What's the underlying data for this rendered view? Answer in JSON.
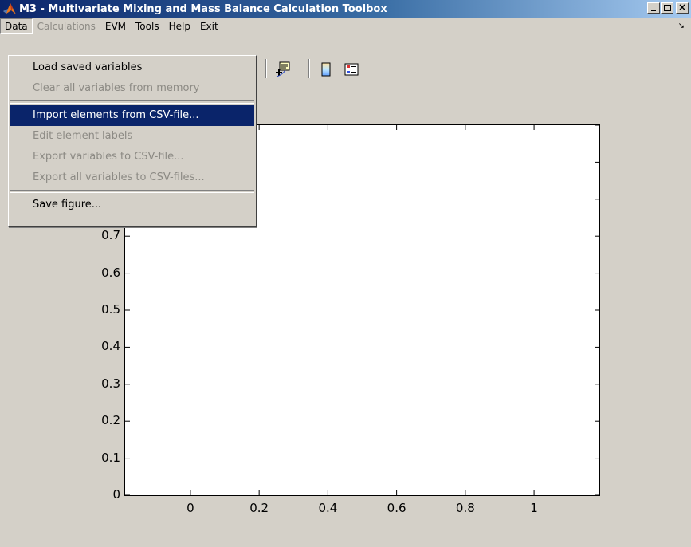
{
  "window": {
    "title": "M3 - Multivariate Mixing and Mass Balance Calculation Toolbox",
    "close_glyph": "×"
  },
  "menubar": {
    "items": [
      {
        "label": "Data",
        "enabled": true,
        "open": true
      },
      {
        "label": "Calculations",
        "enabled": false
      },
      {
        "label": "EVM",
        "enabled": true
      },
      {
        "label": "Tools",
        "enabled": true
      },
      {
        "label": "Help",
        "enabled": true
      },
      {
        "label": "Exit",
        "enabled": true
      }
    ],
    "dock_arrow": "↘"
  },
  "data_menu": {
    "items": [
      {
        "label": "Load saved variables",
        "enabled": true
      },
      {
        "label": "Clear all variables from memory",
        "enabled": false
      },
      {
        "label": "Import elements from CSV-file...",
        "enabled": true,
        "highlighted": true
      },
      {
        "label": "Edit element labels",
        "enabled": false
      },
      {
        "label": "Export variables to CSV-file...",
        "enabled": false
      },
      {
        "label": "Export all variables to CSV-files...",
        "enabled": false
      },
      {
        "label": "Save figure...",
        "enabled": true
      }
    ]
  },
  "toolbar": {
    "icons": [
      "data-cursor-icon",
      "colorbar-icon",
      "legend-icon"
    ]
  },
  "chart_data": {
    "type": "scatter",
    "title": "",
    "xlabel": "",
    "ylabel": "",
    "xlim": [
      -0.19,
      1.19
    ],
    "ylim": [
      0,
      1
    ],
    "x_ticks": [
      "0",
      "0.2",
      "0.4",
      "0.6",
      "0.8",
      "1"
    ],
    "y_ticks": [
      "0",
      "0.1",
      "0.2",
      "0.3",
      "0.4",
      "0.5",
      "0.6",
      "0.7"
    ],
    "series": []
  },
  "colors": {
    "title_bar_start": "#0a246a",
    "title_bar_end": "#a6caf0",
    "face": "#d4d0c8",
    "menu_highlight": "#0a246a",
    "disabled_text": "#8c8a84"
  }
}
